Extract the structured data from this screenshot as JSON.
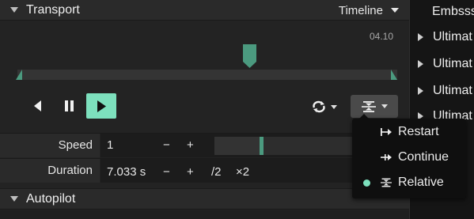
{
  "transport": {
    "title": "Transport",
    "view_select": "Timeline",
    "time_readout": "04.10",
    "progress": 0.6,
    "speed": {
      "label": "Speed",
      "value": "1",
      "minus": "−",
      "plus": "+",
      "slider_fraction": 0.32
    },
    "duration": {
      "label": "Duration",
      "value": "7.033 s",
      "minus": "−",
      "plus": "+",
      "half": "/2",
      "double": "×2"
    }
  },
  "mode_menu": {
    "items": [
      {
        "label": "Restart",
        "icon": "restart-icon",
        "selected": false
      },
      {
        "label": "Continue",
        "icon": "continue-icon",
        "selected": false
      },
      {
        "label": "Relative",
        "icon": "relative-icon",
        "selected": true
      }
    ]
  },
  "autopilot": {
    "title": "Autopilot"
  },
  "right_panel": {
    "items": [
      {
        "label": "Embsss",
        "expandable": false
      },
      {
        "label": "Ultimat",
        "expandable": true
      },
      {
        "label": "Ultimat",
        "expandable": true
      },
      {
        "label": "Ultimat",
        "expandable": true
      },
      {
        "label": "Ultimat",
        "expandable": true
      }
    ]
  },
  "colors": {
    "accent": "#7de0bd",
    "track_accent": "#4b9a7f",
    "panel": "#232323"
  }
}
